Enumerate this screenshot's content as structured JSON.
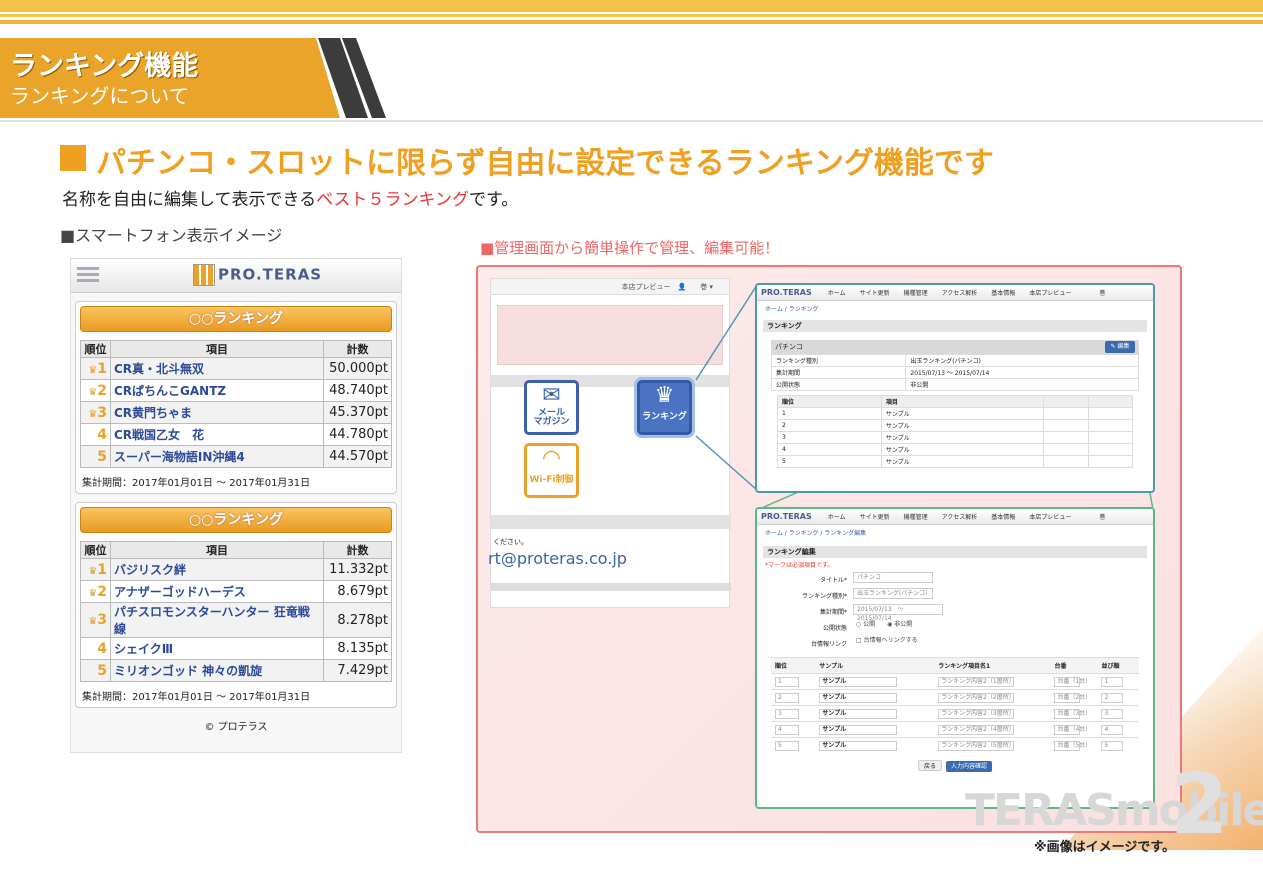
{
  "header": {
    "title": "ランキング機能",
    "subtitle": "ランキングについて"
  },
  "lead": {
    "title": "パチンコ・スロットに限らず自由に設定できるランキング機能です",
    "sub_before": "名称を自由に編集して表示できる",
    "sub_highlight": "ベスト５ランキング",
    "sub_after": "です。"
  },
  "phone_caption": "■スマートフォン表示イメージ",
  "admin_caption": "■管理画面から簡単操作で管理、編集可能！",
  "phone": {
    "logo": "PRO.TERAS",
    "rankings": [
      {
        "title": "○○ランキング",
        "columns": [
          "順位",
          "項目",
          "計数"
        ],
        "rows": [
          {
            "rank": "1",
            "item": "CR真・北斗無双",
            "value": "50.000pt"
          },
          {
            "rank": "2",
            "item": "CRぱちんこGANTZ",
            "value": "48.740pt"
          },
          {
            "rank": "3",
            "item": "CR黄門ちゃま",
            "value": "45.370pt"
          },
          {
            "rank": "4",
            "item": "CR戦国乙女　花",
            "value": "44.780pt"
          },
          {
            "rank": "5",
            "item": "スーパー海物語IN沖縄4",
            "value": "44.570pt"
          }
        ],
        "period": "集計期間：2017年01月01日 ～ 2017年01月31日"
      },
      {
        "title": "○○ランキング",
        "columns": [
          "順位",
          "項目",
          "計数"
        ],
        "rows": [
          {
            "rank": "1",
            "item": "バジリスク絆",
            "value": "11.332pt"
          },
          {
            "rank": "2",
            "item": "アナザーゴッドハーデス",
            "value": "8.679pt"
          },
          {
            "rank": "3",
            "item": "パチスロモンスターハンター 狂竜戦線",
            "value": "8.278pt"
          },
          {
            "rank": "4",
            "item": "シェイクⅢ",
            "value": "8.135pt"
          },
          {
            "rank": "5",
            "item": "ミリオンゴッド 神々の凱旋",
            "value": "7.429pt"
          }
        ],
        "period": "集計期間：2017年01月01日 ～ 2017年01月31日"
      }
    ],
    "copyright": "© プロテラス"
  },
  "admin_left": {
    "topbar": "本店プレビュー",
    "tile_mail": "メール\nマガジン",
    "tile_rank": "ランキング",
    "tile_wifi": "Wi-Fi制御",
    "contact_note": "ください。",
    "email": "rt@proteras.co.jp"
  },
  "panel1": {
    "logo": "PRO.TERAS",
    "nav": [
      "ホーム",
      "サイト更新",
      "機種管理",
      "アクセス解析",
      "基本情報",
      "本店プレビュー",
      "",
      "巻"
    ],
    "crumb": "ホーム / ランキング",
    "section": "ランキング",
    "bar": "パチンコ",
    "edit": "編集",
    "info": [
      [
        "ランキング種別",
        "出玉ランキング(パチンコ)"
      ],
      [
        "集計期間",
        "2015/07/13 ～ 2015/07/14"
      ],
      [
        "公開状態",
        "非公開"
      ]
    ],
    "rank_head": [
      "順位",
      "項目"
    ],
    "rank_rows": [
      [
        "1",
        "サンプル"
      ],
      [
        "2",
        "サンプル"
      ],
      [
        "3",
        "サンプル"
      ],
      [
        "4",
        "サンプル"
      ],
      [
        "5",
        "サンプル"
      ]
    ]
  },
  "panel2": {
    "crumb": "ホーム / ランキング / ランキング編集",
    "section": "ランキング編集",
    "note": "*マークは必須項目です。",
    "form": [
      [
        "タイトル*",
        "パチンコ"
      ],
      [
        "ランキング種別*",
        "出玉ランキング(パチンコ)"
      ],
      [
        "集計期間*",
        "2015/07/13　～　2015/07/14"
      ],
      [
        "公開状態",
        "○ 公開　　◉ 非公開"
      ],
      [
        "台情報リンク",
        "□ 台情報へリンクする"
      ]
    ],
    "head": [
      "順位",
      "サンプル",
      "ランキング項目名1",
      "台番",
      "並び順"
    ],
    "rows": [
      [
        "1",
        "サンプル",
        "ランキング内容2（1箇所）",
        "台番（1台）",
        "1"
      ],
      [
        "2",
        "サンプル",
        "ランキング内容2（2箇所）",
        "台番（2台）",
        "2"
      ],
      [
        "3",
        "サンプル",
        "ランキング内容2（3箇所）",
        "台番（3台）",
        "3"
      ],
      [
        "4",
        "サンプル",
        "ランキング内容2（4箇所）",
        "台番（4台）",
        "4"
      ],
      [
        "5",
        "サンプル",
        "ランキング内容2（5箇所）",
        "台番（5台）",
        "5"
      ]
    ],
    "btn_back": "戻る",
    "btn_ok": "入力内容確認"
  },
  "watermark": "TERASmobile",
  "watermark_num": "2",
  "note": "※画像はイメージです。"
}
